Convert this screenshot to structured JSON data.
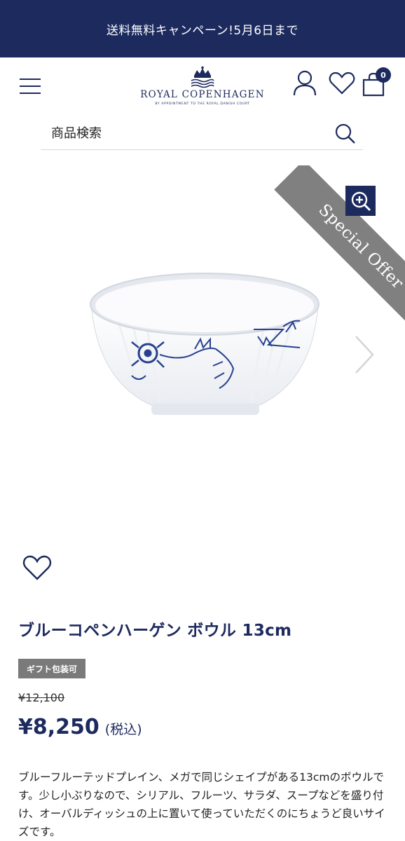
{
  "promo": {
    "text": "送料無料キャンペーン!5月6日まで"
  },
  "header": {
    "menu_icon": "hamburger-menu-icon",
    "logo": {
      "name": "ROYAL COPENHAGEN",
      "subtitle": "BY APPOINTMENT TO THE ROYAL DANISH COURT"
    },
    "account_icon": "user-icon",
    "wishlist_icon": "heart-icon",
    "cart": {
      "icon": "shopping-bag-icon",
      "count": "0"
    }
  },
  "search": {
    "placeholder": "商品検索",
    "icon": "search-icon"
  },
  "gallery": {
    "ribbon": "Special Offer",
    "zoom_icon": "zoom-in-icon",
    "next_icon": "chevron-right-icon",
    "image": "blue-fluted-mega-bowl"
  },
  "favorite_icon": "heart-outline-icon",
  "product": {
    "title": "ブルーコペンハーゲン ボウル 13cm",
    "badge": "ギフト包装可",
    "old_price": "¥12,100",
    "price": "¥8,250",
    "tax_label": "(税込)",
    "description": "ブルーフルーテッドプレイン、メガで同じシェイプがある13cmのボウルです。少し小ぶりなので、シリアル、フルーツ、サラダ、スープなどを盛り付け、オーバルディッシュの上に置いて使っていただくのにちょうど良いサイズです。"
  },
  "colors": {
    "brand_navy": "#1d2a5e",
    "ribbon_gray": "#808080",
    "badge_gray": "#7a7a7a"
  }
}
